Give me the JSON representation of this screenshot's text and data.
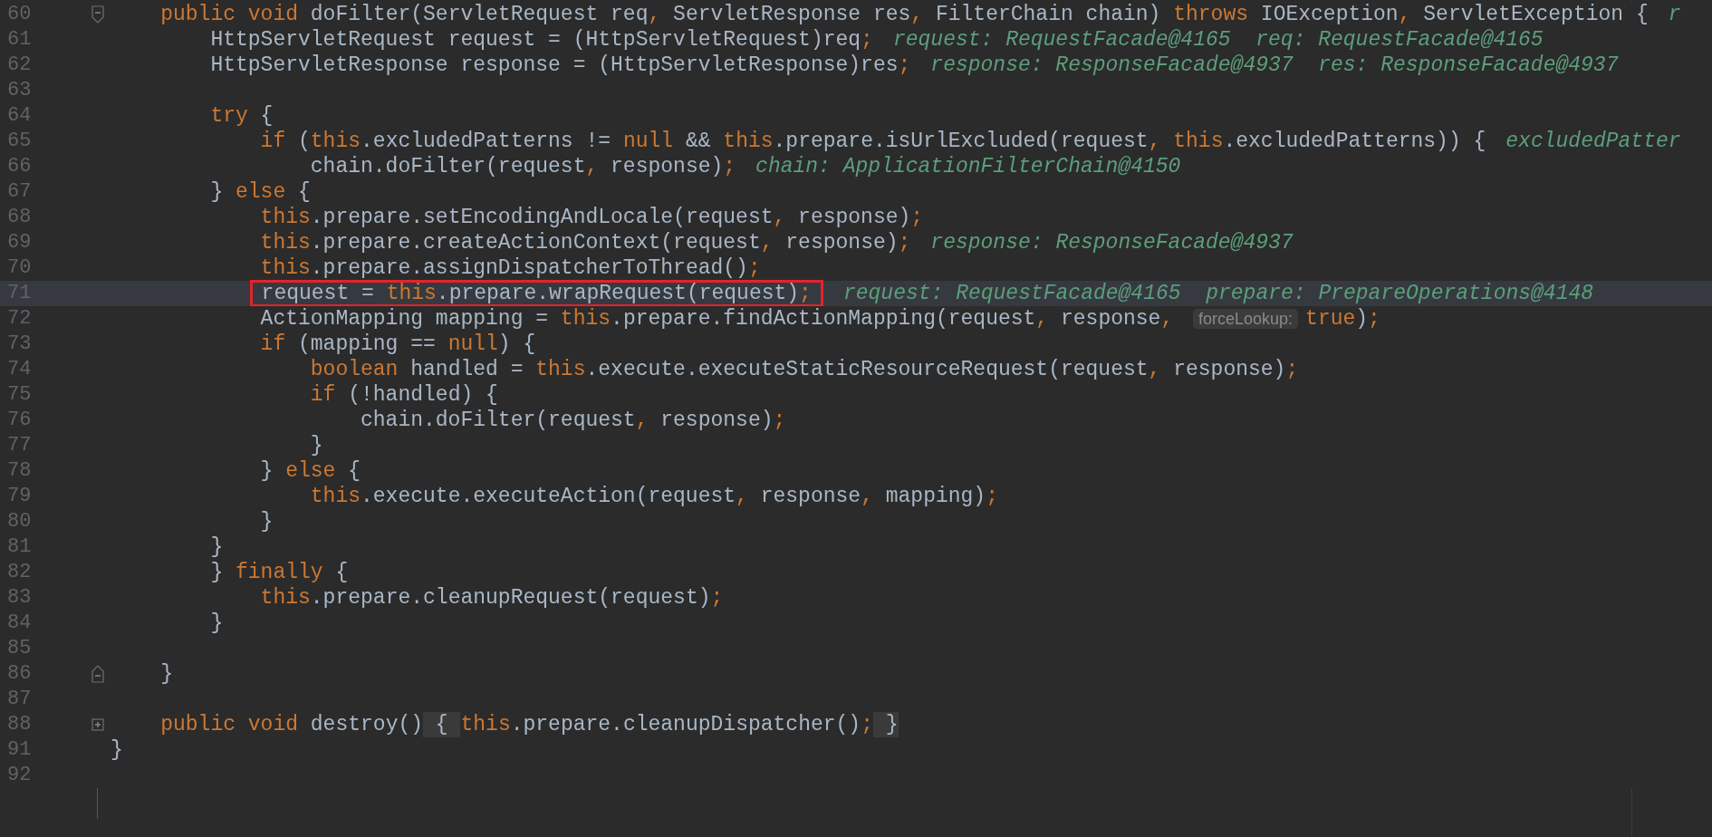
{
  "editor": {
    "class_body": [
      {
        "number": "60",
        "kind": "fold_start",
        "current": false,
        "tokens": [
          {
            "kind": "k",
            "text": "public void"
          },
          {
            "kind": "t",
            "text": " doFilter(ServletRequest req"
          },
          {
            "kind": "k",
            "text": ", "
          },
          {
            "kind": "t",
            "text": "ServletResponse res"
          },
          {
            "kind": "k",
            "text": ", "
          },
          {
            "kind": "t",
            "text": "FilterChain chain) "
          },
          {
            "kind": "k",
            "text": "throws"
          },
          {
            "kind": "t",
            "text": " IOException"
          },
          {
            "kind": "k",
            "text": ", "
          },
          {
            "kind": "t",
            "text": "ServletException {"
          },
          {
            "kind": "h",
            "text": "r"
          }
        ],
        "children": [
          {
            "number": "61",
            "current": false,
            "tokens": [
              {
                "kind": "t",
                "text": "HttpServletRequest request = (HttpServletRequest)req"
              },
              {
                "kind": "k",
                "text": ";"
              },
              {
                "kind": "h",
                "text": "request: RequestFacade@4165  req: RequestFacade@4165"
              }
            ]
          },
          {
            "number": "62",
            "current": false,
            "tokens": [
              {
                "kind": "t",
                "text": "HttpServletResponse response = (HttpServletResponse)res"
              },
              {
                "kind": "k",
                "text": ";"
              },
              {
                "kind": "h",
                "text": "response: ResponseFacade@4937  res: ResponseFacade@4937"
              }
            ]
          },
          {
            "number": "63",
            "current": false
          },
          {
            "number": "64",
            "current": false,
            "tokens": [
              {
                "kind": "k",
                "text": "try"
              },
              {
                "kind": "t",
                "text": " {"
              }
            ],
            "children": [
              {
                "number": "65",
                "current": false,
                "tokens": [
                  {
                    "kind": "k",
                    "text": "if"
                  },
                  {
                    "kind": "t",
                    "text": " ("
                  },
                  {
                    "kind": "k",
                    "text": "this"
                  },
                  {
                    "kind": "t",
                    "text": ".excludedPatterns != "
                  },
                  {
                    "kind": "k",
                    "text": "null"
                  },
                  {
                    "kind": "t",
                    "text": " && "
                  },
                  {
                    "kind": "k",
                    "text": "this"
                  },
                  {
                    "kind": "t",
                    "text": ".prepare.isUrlExcluded(request"
                  },
                  {
                    "kind": "k",
                    "text": ", "
                  },
                  {
                    "kind": "k",
                    "text": "this"
                  },
                  {
                    "kind": "t",
                    "text": ".excludedPatterns)) {"
                  },
                  {
                    "kind": "h",
                    "text": "excludedPatter"
                  }
                ],
                "children": [
                  {
                    "number": "66",
                    "current": false,
                    "tokens": [
                      {
                        "kind": "t",
                        "text": "chain.doFilter(request"
                      },
                      {
                        "kind": "k",
                        "text": ", "
                      },
                      {
                        "kind": "t",
                        "text": "response)"
                      },
                      {
                        "kind": "k",
                        "text": ";"
                      },
                      {
                        "kind": "h",
                        "text": "chain: ApplicationFilterChain@4150"
                      }
                    ]
                  }
                ]
              }
            ]
          },
          {
            "number": "67",
            "current": false,
            "tokens": [
              {
                "kind": "t",
                "text": "} "
              },
              {
                "kind": "k",
                "text": "else"
              },
              {
                "kind": "t",
                "text": " {"
              }
            ],
            "children": [
              {
                "number": "68",
                "current": false,
                "tokens": [
                  {
                    "kind": "k",
                    "text": "this"
                  },
                  {
                    "kind": "t",
                    "text": ".prepare.setEncodingAndLocale(request"
                  },
                  {
                    "kind": "k",
                    "text": ", "
                  },
                  {
                    "kind": "t",
                    "text": "response)"
                  },
                  {
                    "kind": "k",
                    "text": ";"
                  }
                ]
              },
              {
                "number": "69",
                "current": false,
                "tokens": [
                  {
                    "kind": "k",
                    "text": "this"
                  },
                  {
                    "kind": "t",
                    "text": ".prepare.createActionContext(request"
                  },
                  {
                    "kind": "k",
                    "text": ", "
                  },
                  {
                    "kind": "t",
                    "text": "response)"
                  },
                  {
                    "kind": "k",
                    "text": ";"
                  },
                  {
                    "kind": "h",
                    "text": "response: ResponseFacade@4937"
                  }
                ]
              },
              {
                "number": "70",
                "current": false,
                "tokens": [
                  {
                    "kind": "k",
                    "text": "this"
                  },
                  {
                    "kind": "t",
                    "text": ".prepare.assignDispatcherToThread()"
                  },
                  {
                    "kind": "k",
                    "text": ";"
                  }
                ]
              },
              {
                "number": "71",
                "current": true,
                "tokens": [
                  {
                    "kind": "box",
                    "children": [
                      {
                        "kind": "t",
                        "text": "request = "
                      },
                      {
                        "kind": "k",
                        "text": "this"
                      },
                      {
                        "kind": "t",
                        "text": ".prepare.wrapRequest(request)"
                      },
                      {
                        "kind": "k",
                        "text": ";"
                      }
                    ]
                  },
                  {
                    "kind": "h",
                    "text": "request: RequestFacade@4165  prepare: PrepareOperations@4148"
                  }
                ]
              },
              {
                "number": "72",
                "current": false,
                "tokens": [
                  {
                    "kind": "t",
                    "text": "ActionMapping mapping = "
                  },
                  {
                    "kind": "k",
                    "text": "this"
                  },
                  {
                    "kind": "t",
                    "text": ".prepare.findActionMapping(request"
                  },
                  {
                    "kind": "k",
                    "text": ", "
                  },
                  {
                    "kind": "t",
                    "text": "response"
                  },
                  {
                    "kind": "k",
                    "text": ", "
                  },
                  {
                    "kind": "p",
                    "text": "forceLookup:"
                  },
                  {
                    "kind": "k",
                    "text": "true"
                  },
                  {
                    "kind": "t",
                    "text": ")"
                  },
                  {
                    "kind": "k",
                    "text": ";"
                  }
                ]
              },
              {
                "number": "73",
                "current": false,
                "tokens": [
                  {
                    "kind": "k",
                    "text": "if"
                  },
                  {
                    "kind": "t",
                    "text": " (mapping == "
                  },
                  {
                    "kind": "k",
                    "text": "null"
                  },
                  {
                    "kind": "t",
                    "text": ") {"
                  }
                ],
                "children": [
                  {
                    "number": "74",
                    "current": false,
                    "tokens": [
                      {
                        "kind": "k",
                        "text": "boolean"
                      },
                      {
                        "kind": "t",
                        "text": " handled = "
                      },
                      {
                        "kind": "k",
                        "text": "this"
                      },
                      {
                        "kind": "t",
                        "text": ".execute.executeStaticResourceRequest(request"
                      },
                      {
                        "kind": "k",
                        "text": ", "
                      },
                      {
                        "kind": "t",
                        "text": "response)"
                      },
                      {
                        "kind": "k",
                        "text": ";"
                      }
                    ]
                  },
                  {
                    "number": "75",
                    "current": false,
                    "tokens": [
                      {
                        "kind": "k",
                        "text": "if"
                      },
                      {
                        "kind": "t",
                        "text": " (!handled) {"
                      }
                    ],
                    "children": [
                      {
                        "number": "76",
                        "current": false,
                        "tokens": [
                          {
                            "kind": "t",
                            "text": "chain.doFilter(request"
                          },
                          {
                            "kind": "k",
                            "text": ", "
                          },
                          {
                            "kind": "t",
                            "text": "response)"
                          },
                          {
                            "kind": "k",
                            "text": ";"
                          }
                        ]
                      }
                    ]
                  },
                  {
                    "number": "77",
                    "current": false,
                    "tokens": [
                      {
                        "kind": "t",
                        "text": "}"
                      }
                    ]
                  }
                ]
              },
              {
                "number": "78",
                "current": false,
                "tokens": [
                  {
                    "kind": "t",
                    "text": "} "
                  },
                  {
                    "kind": "k",
                    "text": "else"
                  },
                  {
                    "kind": "t",
                    "text": " {"
                  }
                ],
                "children": [
                  {
                    "number": "79",
                    "current": false,
                    "tokens": [
                      {
                        "kind": "k",
                        "text": "this"
                      },
                      {
                        "kind": "t",
                        "text": ".execute.executeAction(request"
                      },
                      {
                        "kind": "k",
                        "text": ", "
                      },
                      {
                        "kind": "t",
                        "text": "response"
                      },
                      {
                        "kind": "k",
                        "text": ", "
                      },
                      {
                        "kind": "t",
                        "text": "mapping)"
                      },
                      {
                        "kind": "k",
                        "text": ";"
                      }
                    ]
                  }
                ]
              },
              {
                "number": "80",
                "current": false,
                "tokens": [
                  {
                    "kind": "t",
                    "text": "}"
                  }
                ]
              }
            ]
          },
          {
            "number": "81",
            "current": false,
            "tokens": [
              {
                "kind": "t",
                "text": "}"
              }
            ]
          },
          {
            "number": "82",
            "current": false,
            "tokens": [
              {
                "kind": "t",
                "text": "} "
              },
              {
                "kind": "k",
                "text": "finally"
              },
              {
                "kind": "t",
                "text": " {"
              }
            ],
            "children": [
              {
                "number": "83",
                "current": false,
                "tokens": [
                  {
                    "kind": "k",
                    "text": "this"
                  },
                  {
                    "kind": "t",
                    "text": ".prepare.cleanupRequest(request)"
                  },
                  {
                    "kind": "k",
                    "text": ";"
                  }
                ]
              }
            ]
          },
          {
            "number": "84",
            "current": false,
            "tokens": [
              {
                "kind": "t",
                "text": "}"
              }
            ]
          },
          {
            "number": "85",
            "current": false
          }
        ]
      },
      {
        "number": "86",
        "kind": "fold_end",
        "current": false,
        "tokens": [
          {
            "kind": "t",
            "text": "}"
          }
        ]
      },
      {
        "number": "87",
        "current": false
      },
      {
        "number": "88",
        "kind": "folded",
        "current": false,
        "tokens": [
          {
            "kind": "k",
            "text": "public void"
          },
          {
            "kind": "t",
            "text": " destroy()"
          },
          {
            "kind": "f",
            "text": " { "
          },
          {
            "kind": "k",
            "text": "this"
          },
          {
            "kind": "t",
            "text": ".prepare.cleanupDispatcher()"
          },
          {
            "kind": "k",
            "text": ";"
          },
          {
            "kind": "f",
            "text": " }"
          }
        ]
      }
    ],
    "tail": [
      {
        "number": "91",
        "current": false,
        "tokens": [
          {
            "kind": "t",
            "text": "}"
          }
        ]
      },
      {
        "number": "92",
        "current": false
      }
    ]
  }
}
